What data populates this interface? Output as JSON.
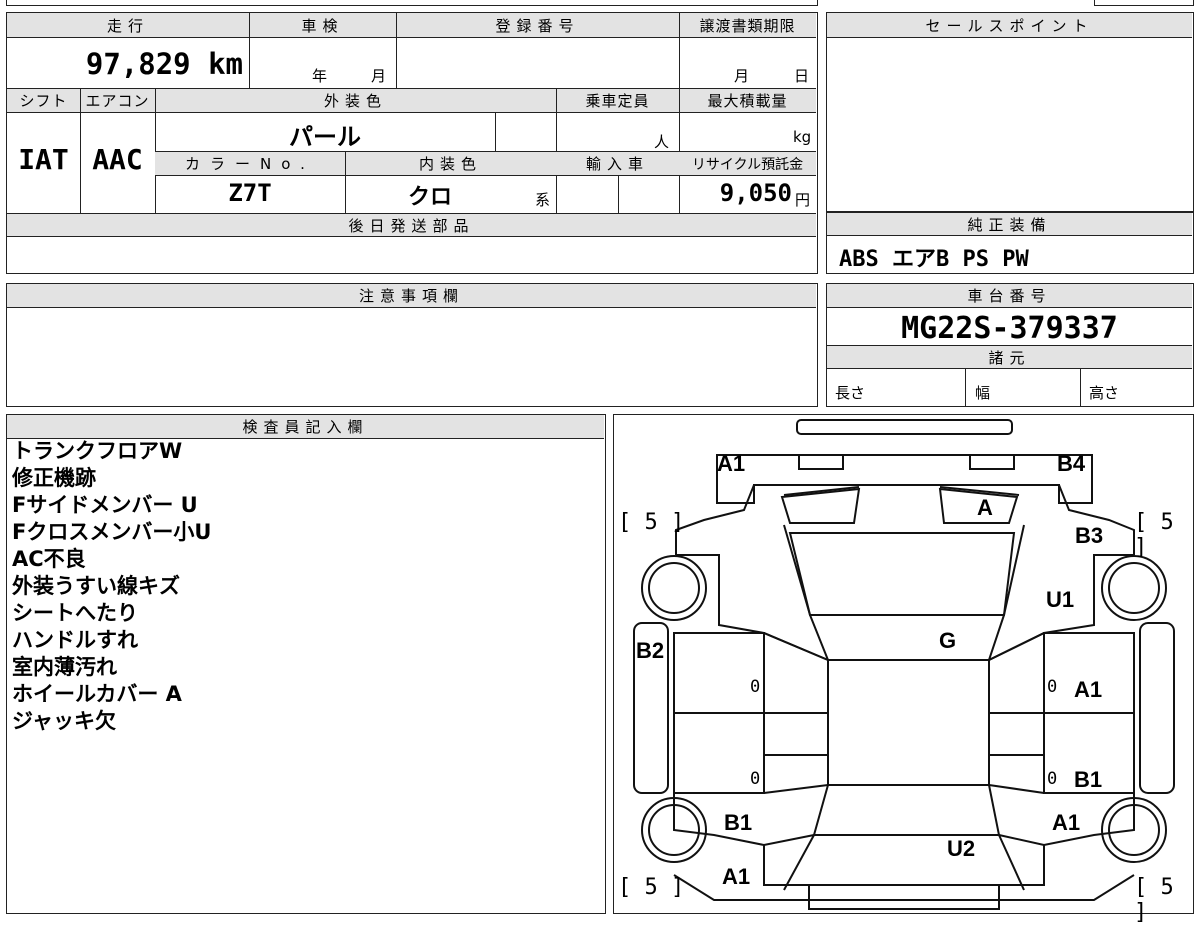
{
  "top_table": {
    "mileage": {
      "header": "走行",
      "value": "97,829 km"
    },
    "inspection": {
      "header": "車検",
      "year_label": "年",
      "month_label": "月"
    },
    "registration": {
      "header": "登録番号"
    },
    "transfer_deadline": {
      "header": "譲渡書類期限",
      "month_label": "月",
      "day_label": "日"
    },
    "shift": {
      "header": "シフト",
      "value": "IAT"
    },
    "aircon": {
      "header": "エアコン",
      "value": "AAC"
    },
    "exterior_color": {
      "header": "外装色",
      "value": "パール"
    },
    "capacity": {
      "header": "乗車定員",
      "unit": "人"
    },
    "max_load": {
      "header": "最大積載量",
      "unit": "kg"
    },
    "color_no": {
      "header": "カラーNo.",
      "value": "Z7T"
    },
    "interior_color": {
      "header": "内装色",
      "value": "クロ",
      "suffix": "系"
    },
    "import": {
      "header": "輸入車"
    },
    "recycle_fee": {
      "header": "リサイクル預託金",
      "value": "9,050",
      "unit": "円"
    },
    "later_parts": {
      "header": "後日発送部品"
    }
  },
  "sales_point": {
    "header": "セールスポイント"
  },
  "standard_equipment": {
    "header": "純正装備",
    "value": "ABS エアB PS PW"
  },
  "notice": {
    "header": "注意事項欄"
  },
  "chassis": {
    "header": "車台番号",
    "value": "MG22S-379337"
  },
  "specs": {
    "header": "諸元",
    "length": "長さ",
    "width": "幅",
    "height": "高さ"
  },
  "inspector": {
    "header": "検査員記入欄",
    "notes": [
      "トランクフロアW",
      "修正機跡",
      "Fサイドメンバー U",
      "Fクロスメンバー小U",
      "AC不良",
      "外装うすい線キズ",
      "シートへたり",
      "ハンドルすれ",
      "室内薄汚れ",
      "ホイールカバー A",
      "ジャッキ欠"
    ]
  },
  "diagram": {
    "labels": {
      "a1_rear_left": "A1",
      "b4_rear_right": "B4",
      "a_rear": "A",
      "b3": "B3",
      "u1": "U1",
      "g": "G",
      "b2": "B2",
      "a1_right_rear_door": "A1",
      "b1_right_front_door": "B1",
      "b1_left_front": "B1",
      "a1_right_front": "A1",
      "u2": "U2",
      "a1_front_left": "A1"
    },
    "tire_depth": {
      "tl": "[ 5 ]",
      "tr": "[ 5 ]",
      "bl": "[ 5 ]",
      "br": "[ 5 ]"
    },
    "zeros": {
      "l1": "0",
      "r1": "0",
      "l2": "0",
      "r2": "0"
    }
  }
}
